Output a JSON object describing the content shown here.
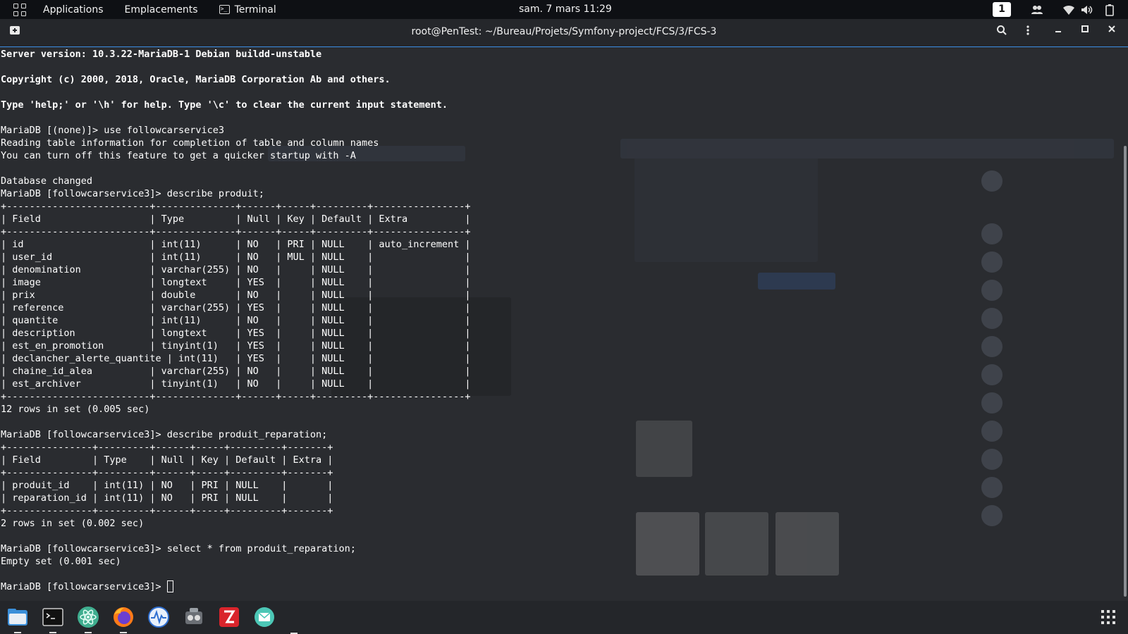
{
  "top_panel": {
    "menu": [
      "Applications",
      "Emplacements",
      "Terminal"
    ],
    "clock": "sam. 7 mars  11:29",
    "workspace": "1"
  },
  "window": {
    "title": "root@PenTest: ~/Bureau/Projets/Symfony-project/FCS/3/FCS-3"
  },
  "terminal": {
    "intro": [
      "Server version: 10.3.22-MariaDB-1 Debian buildd-unstable",
      "",
      "Copyright (c) 2000, 2018, Oracle, MariaDB Corporation Ab and others.",
      "",
      "Type 'help;' or '\\h' for help. Type '\\c' to clear the current input statement.",
      ""
    ],
    "session": [
      "MariaDB [(none)]> use followcarservice3",
      "Reading table information for completion of table and column names",
      "You can turn off this feature to get a quicker startup with -A",
      "",
      "Database changed",
      "MariaDB [followcarservice3]> describe produit;",
      "+-------------------------+--------------+------+-----+---------+----------------+",
      "| Field                   | Type         | Null | Key | Default | Extra          |",
      "+-------------------------+--------------+------+-----+---------+----------------+",
      "| id                      | int(11)      | NO   | PRI | NULL    | auto_increment |",
      "| user_id                 | int(11)      | NO   | MUL | NULL    |                |",
      "| denomination            | varchar(255) | NO   |     | NULL    |                |",
      "| image                   | longtext     | YES  |     | NULL    |                |",
      "| prix                    | double       | NO   |     | NULL    |                |",
      "| reference               | varchar(255) | YES  |     | NULL    |                |",
      "| quantite                | int(11)      | NO   |     | NULL    |                |",
      "| description             | longtext     | YES  |     | NULL    |                |",
      "| est_en_promotion        | tinyint(1)   | YES  |     | NULL    |                |",
      "| declancher_alerte_quantite | int(11)   | YES  |     | NULL    |                |",
      "| chaine_id_alea          | varchar(255) | NO   |     | NULL    |                |",
      "| est_archiver            | tinyint(1)   | NO   |     | NULL    |                |",
      "+-------------------------+--------------+------+-----+---------+----------------+",
      "12 rows in set (0.005 sec)",
      "",
      "MariaDB [followcarservice3]> describe produit_reparation;",
      "+---------------+---------+------+-----+---------+-------+",
      "| Field         | Type    | Null | Key | Default | Extra |",
      "+---------------+---------+------+-----+---------+-------+",
      "| produit_id    | int(11) | NO   | PRI | NULL    |       |",
      "| reparation_id | int(11) | NO   | PRI | NULL    |       |",
      "+---------------+---------+------+-----+---------+-------+",
      "2 rows in set (0.002 sec)",
      "",
      "MariaDB [followcarservice3]> select * from produit_reparation;",
      "Empty set (0.001 sec)",
      ""
    ],
    "prompt": "MariaDB [followcarservice3]> "
  },
  "dock": {
    "items": [
      "files",
      "terminal",
      "atom-editor",
      "firefox",
      "system-monitor",
      "installer",
      "filezilla",
      "mail"
    ]
  },
  "colors": {
    "panel_bg": "#0e1014",
    "titlebar_bg": "#25272b",
    "terminal_bg": "#2a2c30",
    "accent": "#3a8ee6"
  }
}
